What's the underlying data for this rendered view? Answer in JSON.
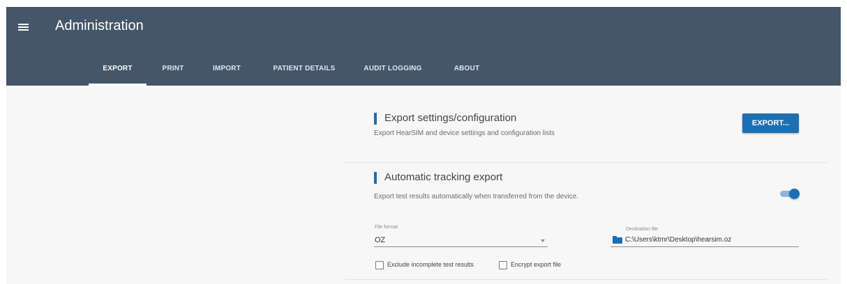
{
  "app": {
    "title": "Administration"
  },
  "tabs": [
    {
      "label": "EXPORT"
    },
    {
      "label": "PRINT"
    },
    {
      "label": "IMPORT"
    },
    {
      "label": "PATIENT DETAILS"
    },
    {
      "label": "AUDIT LOGGING"
    },
    {
      "label": "ABOUT"
    }
  ],
  "active_tab": "EXPORT",
  "export_settings": {
    "title": "Export settings/configuration",
    "description": "Export HearSIM and device settings and configuration lists",
    "button_label": "EXPORT..."
  },
  "tracking_export": {
    "title": "Automatic tracking export",
    "description": "Export test results automatically when transferred from the device.",
    "toggle_on": true,
    "file_format_label": "File format",
    "file_format_value": "OZ",
    "destination_label": "Destination file",
    "destination_value": "C:\\Users\\ktmr\\Desktop\\hearsim.oz",
    "exclude_incomplete_label": "Exclude incomplete test results",
    "exclude_incomplete_checked": false,
    "encrypt_label": "Encrypt export file",
    "encrypt_checked": false
  },
  "colors": {
    "header": "#445669",
    "accent": "#1d6fb3",
    "background": "#f7f7f7"
  },
  "icons": {
    "menu": "hamburger-menu-icon",
    "folder": "folder-icon",
    "dropdown": "chevron-down-icon"
  }
}
